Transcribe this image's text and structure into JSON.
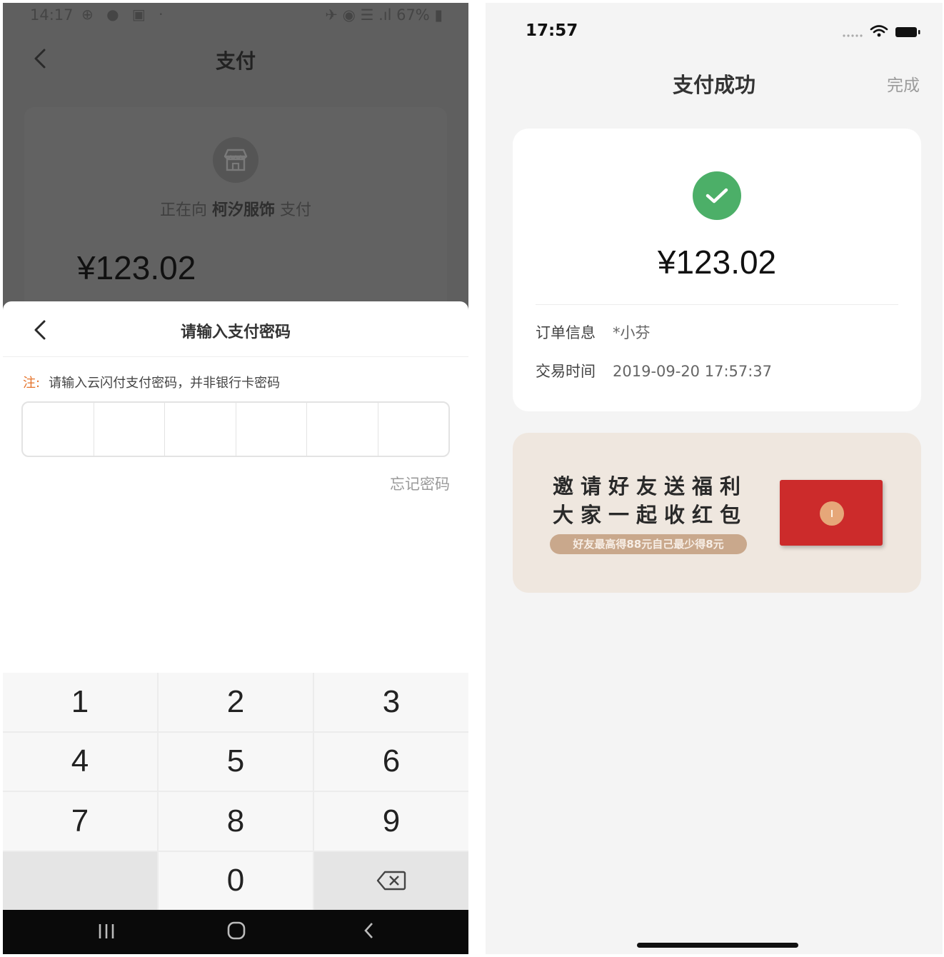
{
  "left_phone": {
    "status": {
      "time": "14:17",
      "icons": "⊕ ● ▣  ·",
      "right": "✈ ◉ ☰ .ıl 67% ▮"
    },
    "header": {
      "title": "支付"
    },
    "merchant": {
      "prefix": "正在向",
      "name": "柯汐服饰",
      "suffix": "支付"
    },
    "amount": "¥123.02",
    "sheet": {
      "title": "请输入支付密码",
      "note_tag": "注:",
      "note_text": "请输入云闪付支付密码，并非银行卡密码",
      "forgot": "忘记密码"
    },
    "keypad": [
      "1",
      "2",
      "3",
      "4",
      "5",
      "6",
      "7",
      "8",
      "9",
      "",
      "0",
      "delete"
    ]
  },
  "right_phone": {
    "status": {
      "time": "17:57"
    },
    "header": {
      "title": "支付成功",
      "done": "完成"
    },
    "amount": "¥123.02",
    "info": {
      "order_label": "订单信息",
      "order_value": "*小芬",
      "time_label": "交易时间",
      "time_value": "2019-09-20 17:57:37"
    },
    "banner": {
      "line1": "邀请好友送福利",
      "line2": "大家一起收红包",
      "pill": "好友最高得88元自己最少得8元"
    },
    "colors": {
      "success": "#4caf68",
      "envelope": "#cc2b2b",
      "accent_note": "#e5732b"
    }
  }
}
